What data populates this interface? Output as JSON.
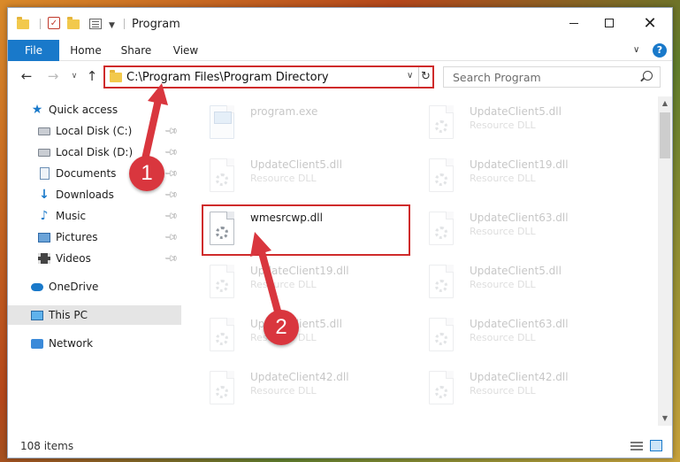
{
  "window": {
    "title": "Program",
    "controls": {
      "minimize": "–",
      "maximize": "",
      "close": "✕"
    }
  },
  "ribbon": {
    "tabs": [
      {
        "label": "File"
      },
      {
        "label": "Home"
      },
      {
        "label": "Share"
      },
      {
        "label": "View"
      }
    ],
    "help": "?"
  },
  "navigation": {
    "address": "C:\\Program Files\\Program Directory",
    "search_placeholder": "Search Program"
  },
  "sidebar": {
    "quick_access": "Quick access",
    "items": [
      {
        "label": "Local Disk (C:)",
        "icon": "drive-icon",
        "pinned": true
      },
      {
        "label": "Local Disk (D:)",
        "icon": "drive-icon",
        "pinned": true
      },
      {
        "label": "Documents",
        "icon": "documents-icon",
        "pinned": true
      },
      {
        "label": "Downloads",
        "icon": "download-icon",
        "pinned": true
      },
      {
        "label": "Music",
        "icon": "music-icon",
        "pinned": true
      },
      {
        "label": "Pictures",
        "icon": "pictures-icon",
        "pinned": true
      },
      {
        "label": "Videos",
        "icon": "videos-icon",
        "pinned": true
      }
    ],
    "onedrive": "OneDrive",
    "this_pc": "This PC",
    "network": "Network"
  },
  "files": [
    {
      "name": "program.exe",
      "type": "",
      "kind": "exe",
      "faded": true
    },
    {
      "name": "UpdateClient5.dll",
      "type": "Resource DLL",
      "kind": "dll",
      "faded": true
    },
    {
      "name": "UpdateClient5.dll",
      "type": "Resource DLL",
      "kind": "dll",
      "faded": true
    },
    {
      "name": "UpdateClient19.dll",
      "type": "Resource DLL",
      "kind": "dll",
      "faded": true
    },
    {
      "name": "wmesrcwp.dll",
      "type": "",
      "kind": "dll",
      "faded": false
    },
    {
      "name": "UpdateClient63.dll",
      "type": "Resource DLL",
      "kind": "dll",
      "faded": true
    },
    {
      "name": "UpdateClient19.dll",
      "type": "Resource DLL",
      "kind": "dll",
      "faded": true
    },
    {
      "name": "UpdateClient5.dll",
      "type": "Resource DLL",
      "kind": "dll",
      "faded": true
    },
    {
      "name": "UpdateClient5.dll",
      "type": "Resource DLL",
      "kind": "dll",
      "faded": true
    },
    {
      "name": "UpdateClient63.dll",
      "type": "Resource DLL",
      "kind": "dll",
      "faded": true
    },
    {
      "name": "UpdateClient42.dll",
      "type": "Resource DLL",
      "kind": "dll",
      "faded": true
    },
    {
      "name": "UpdateClient42.dll",
      "type": "Resource DLL",
      "kind": "dll",
      "faded": true
    }
  ],
  "status": {
    "item_count": "108 items"
  },
  "annotations": {
    "step1": "1",
    "step2": "2",
    "color": "#d9363e"
  }
}
